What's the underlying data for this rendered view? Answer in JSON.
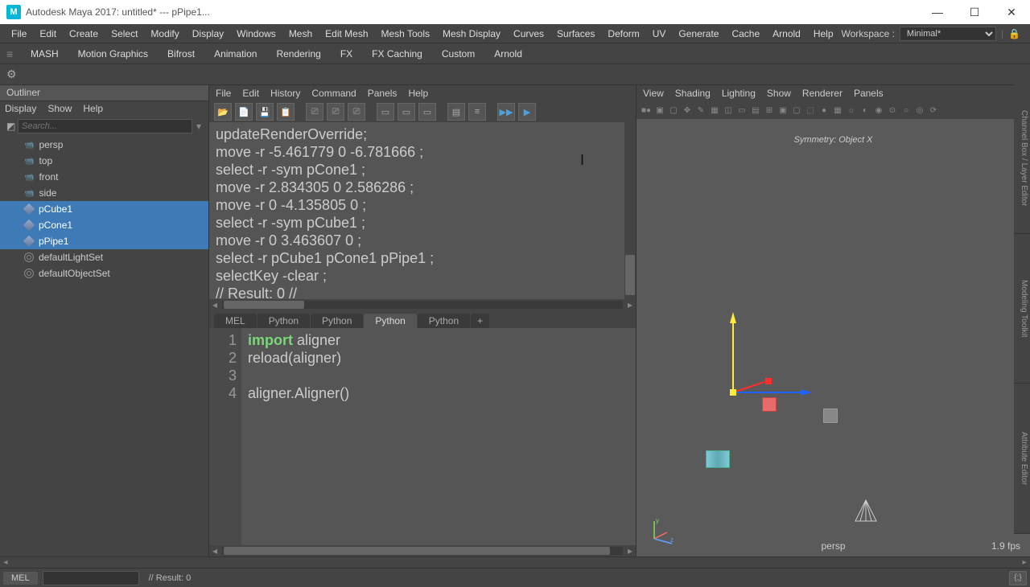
{
  "title": "Autodesk Maya 2017: untitled*  ---  pPipe1...",
  "main_menu": [
    "File",
    "Edit",
    "Create",
    "Select",
    "Modify",
    "Display",
    "Windows",
    "Mesh",
    "Edit Mesh",
    "Mesh Tools",
    "Mesh Display",
    "Curves",
    "Surfaces",
    "Deform",
    "UV",
    "Generate",
    "Cache",
    "Arnold",
    "Help"
  ],
  "workspace": {
    "label": "Workspace :",
    "value": "Minimal*"
  },
  "shelf_tabs": [
    "MASH",
    "Motion Graphics",
    "Bifrost",
    "Animation",
    "Rendering",
    "FX",
    "FX Caching",
    "Custom",
    "Arnold"
  ],
  "outliner": {
    "title": "Outliner",
    "menu": [
      "Display",
      "Show",
      "Help"
    ],
    "search_placeholder": "Search...",
    "items": [
      {
        "label": "persp",
        "type": "cam",
        "sel": false
      },
      {
        "label": "top",
        "type": "cam",
        "sel": false
      },
      {
        "label": "front",
        "type": "cam",
        "sel": false
      },
      {
        "label": "side",
        "type": "cam",
        "sel": false
      },
      {
        "label": "pCube1",
        "type": "mesh",
        "sel": true
      },
      {
        "label": "pCone1",
        "type": "mesh",
        "sel": true
      },
      {
        "label": "pPipe1",
        "type": "mesh",
        "sel": true
      },
      {
        "label": "defaultLightSet",
        "type": "set",
        "sel": false
      },
      {
        "label": "defaultObjectSet",
        "type": "set",
        "sel": false
      }
    ]
  },
  "script_editor": {
    "menu": [
      "File",
      "Edit",
      "History",
      "Command",
      "Panels",
      "Help"
    ],
    "output": "updateRenderOverride;\nmove -r -5.461779 0 -6.781666 ;\nselect -r -sym pCone1 ;\nmove -r 2.834305 0 2.586286 ;\nmove -r 0 -4.135805 0 ;\nselect -r -sym pCube1 ;\nmove -r 0 3.463607 0 ;\nselect -r pCube1 pCone1 pPipe1 ;\nselectKey -clear ;\n// Result: 0 //",
    "tabs": [
      "MEL",
      "Python",
      "Python",
      "Python",
      "Python",
      "+"
    ],
    "active_tab": 3,
    "code_lines": [
      {
        "n": 1,
        "pre": "",
        "kw": "import",
        "post": " aligner"
      },
      {
        "n": 2,
        "pre": "reload(aligner)",
        "kw": "",
        "post": ""
      },
      {
        "n": 3,
        "pre": "",
        "kw": "",
        "post": ""
      },
      {
        "n": 4,
        "pre": "aligner.Aligner()",
        "kw": "",
        "post": ""
      }
    ]
  },
  "viewport": {
    "menu": [
      "View",
      "Shading",
      "Lighting",
      "Show",
      "Renderer",
      "Panels"
    ],
    "symmetry": "Symmetry: Object X",
    "camera": "persp",
    "fps": "1.9 fps"
  },
  "right_rail": [
    "Channel Box / Layer Editor",
    "Modeling Toolkit",
    "Attribute Editor"
  ],
  "cmd": {
    "label": "MEL",
    "result": "// Result: 0"
  }
}
